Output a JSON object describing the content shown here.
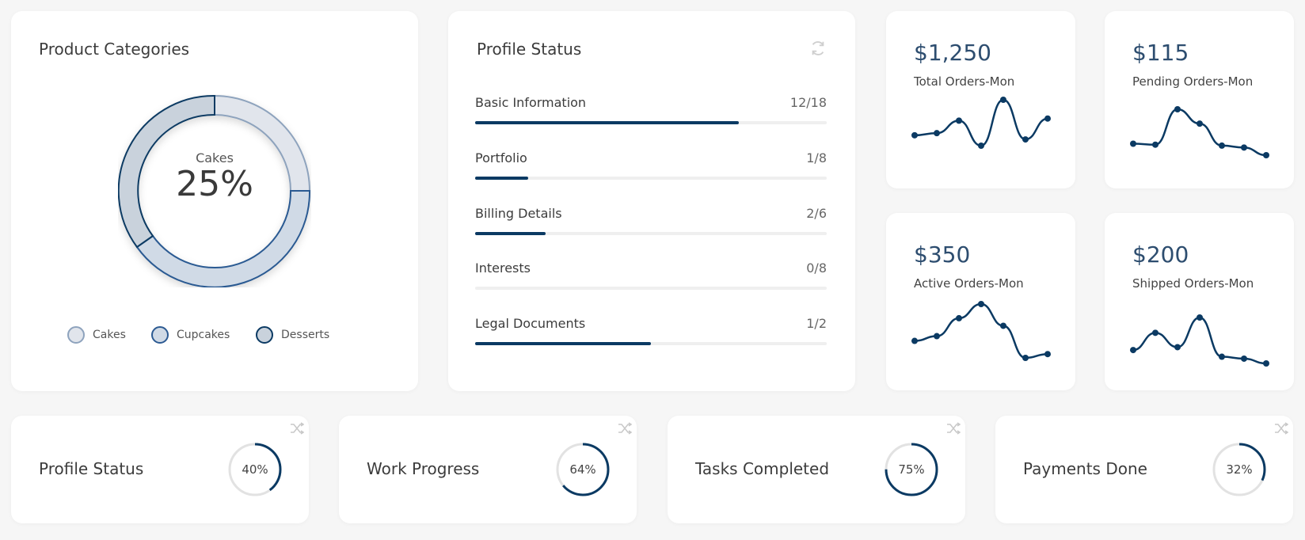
{
  "colors": {
    "accent": "#0b3a63",
    "cakes": "#c5ccd6",
    "cupcakes": "#2c5a92",
    "desserts": "#0b3a63",
    "track": "#e2e2e2"
  },
  "product_categories": {
    "title": "Product Categories",
    "center_label": "Cakes",
    "center_value": "25%",
    "legend": [
      {
        "label": "Cakes",
        "icon": "circle-outline-icon"
      },
      {
        "label": "Cupcakes",
        "icon": "circle-outline-icon"
      },
      {
        "label": "Desserts",
        "icon": "circle-outline-icon"
      }
    ]
  },
  "profile_status": {
    "title": "Profile Status",
    "refresh_icon": "refresh-icon",
    "items": [
      {
        "label": "Basic Information",
        "count": "12/18",
        "progress": 0.75
      },
      {
        "label": "Portfolio",
        "count": "1/8",
        "progress": 0.15
      },
      {
        "label": "Billing Details",
        "count": "2/6",
        "progress": 0.2
      },
      {
        "label": "Interests",
        "count": "0/8",
        "progress": 0
      },
      {
        "label": "Legal Documents",
        "count": "1/2",
        "progress": 0.5
      }
    ]
  },
  "stats": [
    {
      "value": "$1,250",
      "label": "Total Orders-Mon",
      "trend": [
        5,
        6,
        12,
        0,
        22,
        3,
        13
      ]
    },
    {
      "value": "$115",
      "label": "Pending Orders-Mon",
      "trend": [
        14,
        13,
        50,
        35,
        12,
        10,
        2
      ]
    },
    {
      "value": "$350",
      "label": "Active Orders-Mon",
      "trend": [
        18,
        23,
        42,
        57,
        34,
        0,
        4
      ]
    },
    {
      "value": "$200",
      "label": "Shipped Orders-Mon",
      "trend": [
        14,
        32,
        17,
        48,
        7,
        5,
        0
      ]
    }
  ],
  "summary_cards": [
    {
      "title": "Profile Status",
      "percent": 40,
      "percent_label": "40%"
    },
    {
      "title": "Work Progress",
      "percent": 64,
      "percent_label": "64%"
    },
    {
      "title": "Tasks Completed",
      "percent": 75,
      "percent_label": "75%"
    },
    {
      "title": "Payments Done",
      "percent": 32,
      "percent_label": "32%"
    }
  ]
}
